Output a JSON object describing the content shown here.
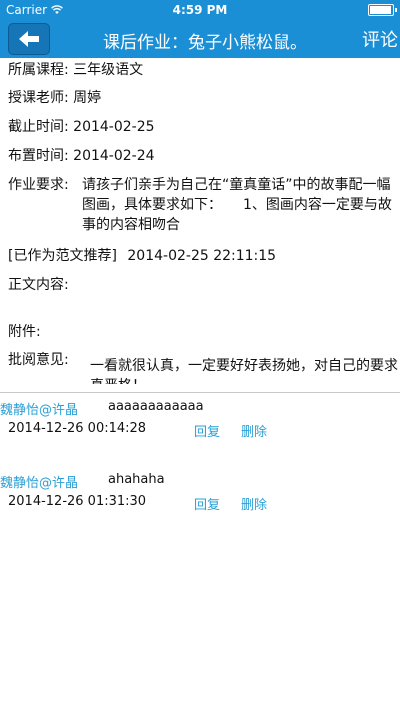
{
  "status_bar": {
    "carrier": "Carrier",
    "time": "4:59 PM"
  },
  "nav": {
    "title": "课后作业：兔子小熊松鼠。",
    "comment_label": "评论"
  },
  "homework": {
    "course_label": "所属课程:",
    "course_value": "三年级语文",
    "teacher_label": "授课老师:",
    "teacher_value": "周婷",
    "deadline_label": "截止时间:",
    "deadline_value": "2014-02-25",
    "assigned_label": "布置时间:",
    "assigned_value": "2014-02-24",
    "requirement_label": "作业要求:",
    "requirement_value": "请孩子们亲手为自己在“童真童话”中的故事配一幅图画，具体要求如下：　　1、图画内容一定要与故事的内容相吻合",
    "recommended_tag": "[已作为范文推荐]",
    "recommended_time": "2014-02-25 22:11:15",
    "body_label": "正文内容:",
    "attachment_label": "附件:",
    "review_label": "批阅意见:",
    "review_value": "一看就很认真，一定要好好表扬她，对自己的要求真严格！"
  },
  "comments": [
    {
      "author": "魏静怡@许晶",
      "content": "aaaaaaaaaaaa",
      "date": "2014-12-26 00:14:28",
      "reply_label": "回复",
      "delete_label": "删除"
    },
    {
      "author": "魏静怡@许晶",
      "content": "ahahaha",
      "date": "2014-12-26 01:31:30",
      "reply_label": "回复",
      "delete_label": "删除"
    }
  ],
  "colors": {
    "nav_bg": "#1b8fd6",
    "link": "#2a9fd6"
  }
}
